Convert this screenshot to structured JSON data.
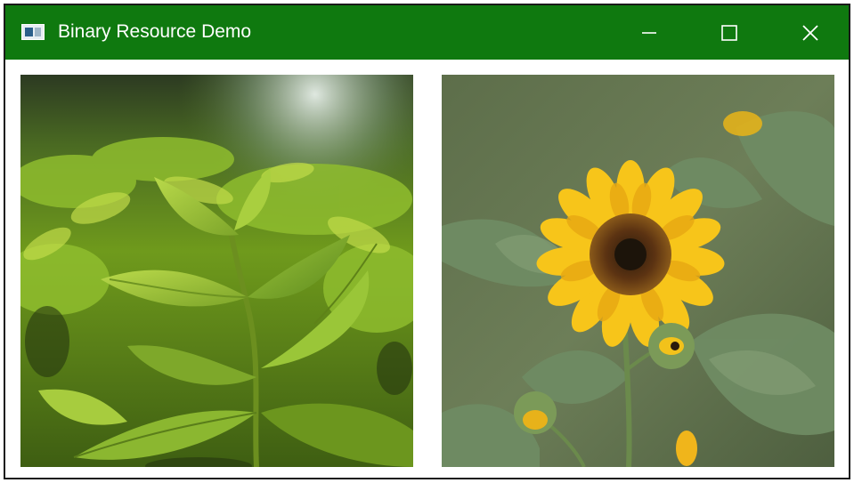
{
  "window": {
    "title": "Binary Resource Demo",
    "icon": "window-app-icon",
    "controls": {
      "minimize_icon": "minimize-icon",
      "maximize_icon": "maximize-icon",
      "close_icon": "close-icon"
    },
    "titlebar_color": "#0f790f"
  },
  "images": [
    {
      "subject": "green-leaves-photo"
    },
    {
      "subject": "sunflower-photo"
    }
  ]
}
